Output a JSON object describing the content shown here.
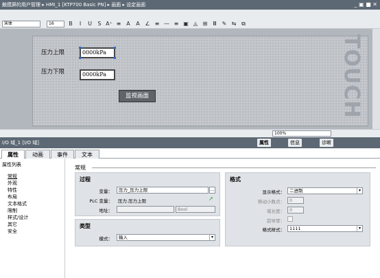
{
  "window": {
    "breadcrumb": "触摸屏的用户管理 ▸ HMI_1 [KTP700 Basic PN] ▸ 画面 ▸ 设定画面",
    "controls": "_ ▣ ■ ✕"
  },
  "toolbar": {
    "font_name": "宋体",
    "font_size": "16",
    "buttons": [
      "B",
      "I",
      "U",
      "S",
      "A⁺",
      "≡",
      "A",
      "A",
      "∠",
      "≡",
      "—",
      "≡",
      "▣",
      "◬",
      "⊞",
      "Ⅲ",
      "✎",
      "⇆",
      "⧉"
    ]
  },
  "screen": {
    "label_upper": "压力上限",
    "label_lower": "压力下限",
    "field_upper": "0000kPa",
    "field_lower": "0000kPa",
    "monitor_button": "监视画面",
    "touch_text": "TOUCH"
  },
  "statusbar": {
    "zoom": "100%"
  },
  "inspector": {
    "title": "I/O 域_1 [I/O 域]",
    "tabs_right": [
      "属性",
      "信息",
      "诊断"
    ],
    "tabs": [
      "属性",
      "动画",
      "事件",
      "文本"
    ],
    "active_tab": "属性"
  },
  "sidebar": {
    "header": "属性列表",
    "items": [
      "常规",
      "外观",
      "特性",
      "布局",
      "文本格式",
      "限制",
      "样式/设计",
      "其它",
      "安全"
    ]
  },
  "content": {
    "section_title": "常规",
    "process": {
      "title": "过程",
      "variable_label": "变量：",
      "variable_value": "压力_压力上限",
      "plc_label": "PLC 变量：",
      "plc_value": "压力.压力上限",
      "address_label": "地址：",
      "address_value": "",
      "type_value": "Bool"
    },
    "type": {
      "title": "类型",
      "mode_label": "模式：",
      "mode_value": "输入"
    },
    "format": {
      "title": "格式",
      "display_label": "显示格式：",
      "display_value": "二进制",
      "decimals_label": "移动小数点：",
      "decimals_value": "0",
      "length_label": "域长度：",
      "length_value": "0",
      "leading_label": "前导零：",
      "pattern_label": "格式样式：",
      "pattern_value": "1111"
    }
  }
}
